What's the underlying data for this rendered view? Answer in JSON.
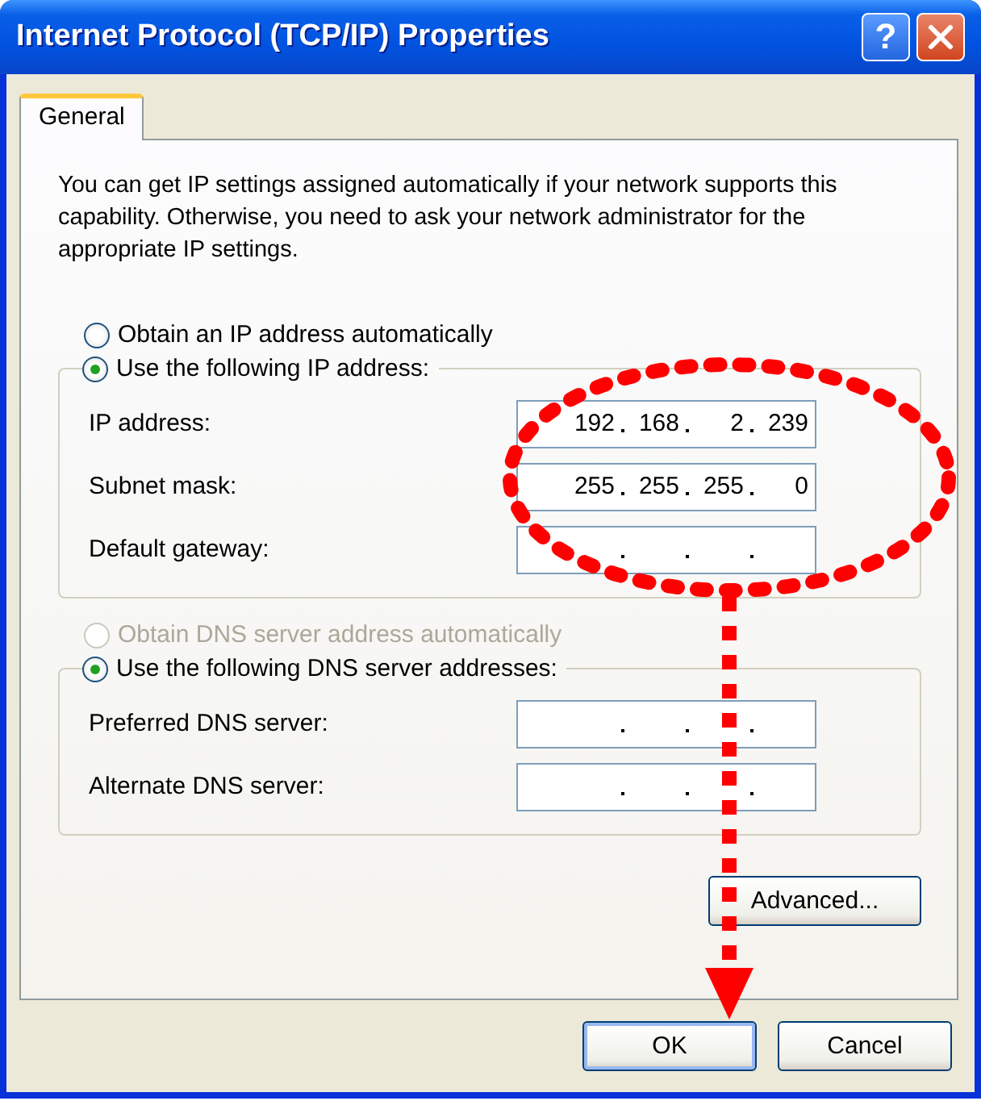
{
  "window": {
    "title": "Internet Protocol (TCP/IP) Properties",
    "title_buttons": [
      {
        "kind": "help",
        "label": "?"
      },
      {
        "kind": "close"
      }
    ]
  },
  "tabs": [
    {
      "label": "General",
      "selected": true
    }
  ],
  "intro": "You can get IP settings assigned automatically if your network supports this capability. Otherwise, you need to ask your network administrator for the appropriate IP settings.",
  "ip_mode": [
    {
      "label": "Obtain an IP address automatically",
      "selected": false,
      "disabled": false
    },
    {
      "label": "Use the following IP address:",
      "selected": true,
      "disabled": false
    }
  ],
  "ip_fields": [
    {
      "label": "IP address:",
      "octets": [
        "192",
        "168",
        "2",
        "239"
      ]
    },
    {
      "label": "Subnet mask:",
      "octets": [
        "255",
        "255",
        "255",
        "0"
      ]
    },
    {
      "label": "Default gateway:"
    }
  ],
  "dns_mode": [
    {
      "label": "Obtain DNS server address automatically",
      "selected": false,
      "disabled": true
    },
    {
      "label": "Use the following DNS server addresses:",
      "selected": true,
      "disabled": false
    }
  ],
  "dns_fields": [
    {
      "label": "Preferred DNS server:"
    },
    {
      "label": "Alternate DNS server:"
    }
  ],
  "panel_buttons": [
    {
      "label": "Advanced..."
    }
  ],
  "dialog_buttons": [
    {
      "label": "OK",
      "default": true
    },
    {
      "label": "Cancel",
      "default": false
    }
  ],
  "annotations": [
    {
      "kind": "ellipse"
    },
    {
      "kind": "arrow"
    }
  ]
}
